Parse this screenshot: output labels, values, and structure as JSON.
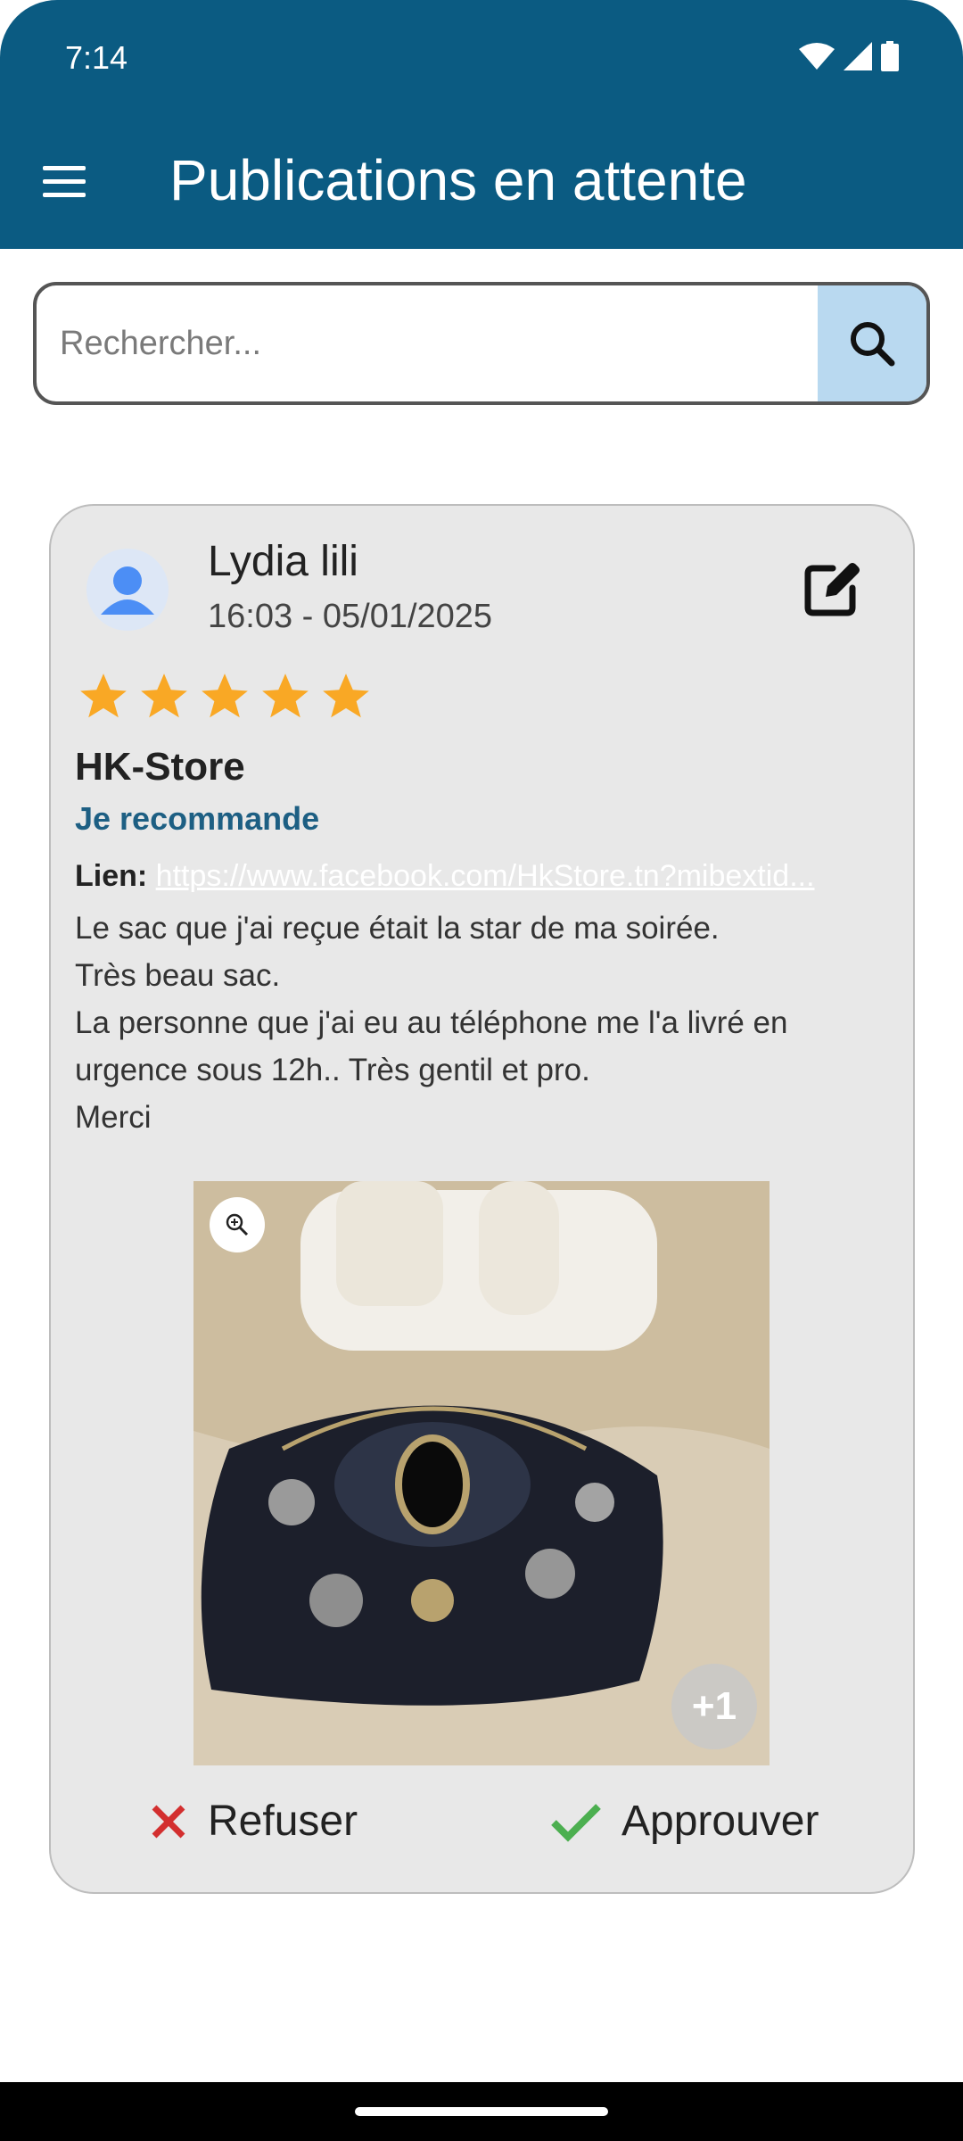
{
  "status": {
    "time": "7:14"
  },
  "appbar": {
    "title": "Publications en attente"
  },
  "search": {
    "placeholder": "Rechercher..."
  },
  "post": {
    "author": "Lydia lili",
    "date": "16:03 - 05/01/2025",
    "rating": 5,
    "store": "HK-Store",
    "recommendation": "Je recommande",
    "link_label": "Lien:",
    "link_url": "https://www.facebook.com/HkStore.tn?mibextid...",
    "review_lines": [
      "Le sac que j'ai reçue était la star de ma soirée.",
      "Très beau sac.",
      "La personne que j'ai eu au téléphone me l'a livré en",
      "urgence sous 12h.. Très gentil et pro.",
      "Merci"
    ],
    "more_images": "+1"
  },
  "actions": {
    "refuse_label": "Refuser",
    "approve_label": "Approuver"
  },
  "colors": {
    "primary": "#0b5b82",
    "star": "#f9a825",
    "refuse": "#d32f2f",
    "approve": "#4caf50",
    "link": "#1d5f83"
  }
}
